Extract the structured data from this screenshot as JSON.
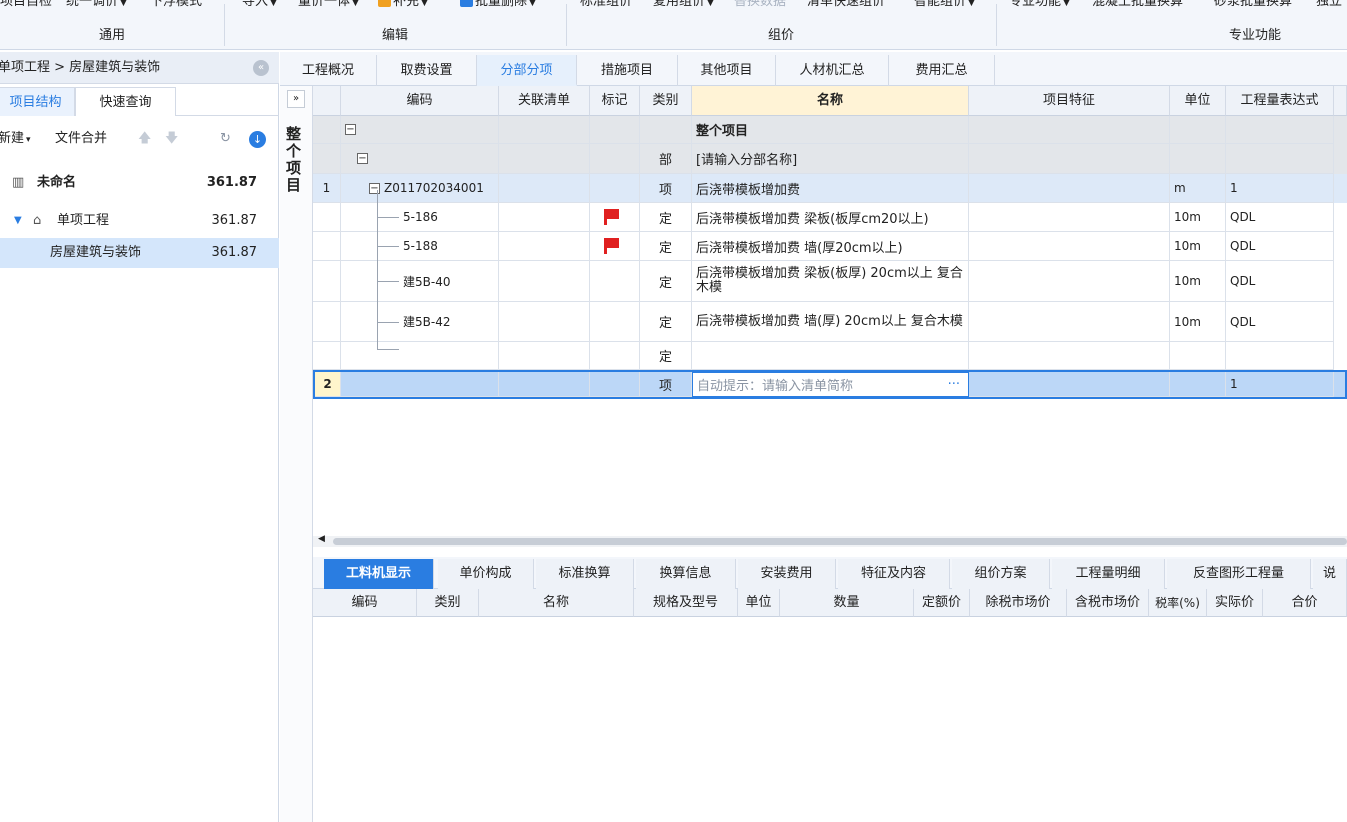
{
  "toolbar": {
    "row1": {
      "project_check": "项目自检",
      "unified_adjust": "统一调价",
      "float_mode": "下浮模式",
      "import": "导入",
      "price_volume": "量价一体",
      "supplement": "补充",
      "batch_delete": "批量删除",
      "standard_pricing": "标准组价",
      "reuse_pricing": "复用组价",
      "replace_data": "替换数据",
      "list_quick_pricing": "清单快速组价",
      "smart_pricing": "智能组价",
      "pro_function": "专业功能",
      "concrete_batch": "混凝土批量换算",
      "mortar_batch": "砂浆批量换算",
      "independent": "独立"
    },
    "groups": {
      "general": "通用",
      "edit": "编辑",
      "pricing": "组价",
      "professional": "专业功能"
    }
  },
  "left": {
    "breadcrumb": "单项工程 > 房屋建筑与装饰",
    "tabs": [
      "项目结构",
      "快速查询"
    ],
    "tools": {
      "new": "新建",
      "merge": "文件合并"
    },
    "tree": [
      {
        "label": "未命名",
        "value": "361.87"
      },
      {
        "label": "单项工程",
        "value": "361.87"
      },
      {
        "label": "房屋建筑与装饰",
        "value": "361.87"
      }
    ]
  },
  "gutter_label": "整个项目",
  "main_tabs": [
    "工程概况",
    "取费设置",
    "分部分项",
    "措施项目",
    "其他项目",
    "人材机汇总",
    "费用汇总"
  ],
  "grid": {
    "headers": [
      "编码",
      "关联清单",
      "标记",
      "类别",
      "名称",
      "项目特征",
      "单位",
      "工程量表达式"
    ],
    "rows": [
      {
        "num": "",
        "code": "",
        "type": "",
        "name": "整个项目",
        "unit": "",
        "expr": ""
      },
      {
        "num": "",
        "code": "",
        "type": "部",
        "name": "[请输入分部名称]",
        "unit": "",
        "expr": ""
      },
      {
        "num": "1",
        "code": "Z011702034001",
        "type": "项",
        "name": "后浇带模板增加费",
        "unit": "m",
        "expr": "1"
      },
      {
        "num": "",
        "code": "5-186",
        "type": "定",
        "name": "后浇带模板增加费 梁板(板厚cm20以上)",
        "unit": "10m",
        "expr": "QDL"
      },
      {
        "num": "",
        "code": "5-188",
        "type": "定",
        "name": "后浇带模板增加费 墙(厚20cm以上)",
        "unit": "10m",
        "expr": "QDL"
      },
      {
        "num": "",
        "code": "建5B-40",
        "type": "定",
        "name": "后浇带模板增加费 梁板(板厚) 20cm以上 复合木模",
        "unit": "10m",
        "expr": "QDL"
      },
      {
        "num": "",
        "code": "建5B-42",
        "type": "定",
        "name": "后浇带模板增加费 墙(厚) 20cm以上 复合木模",
        "unit": "10m",
        "expr": "QDL"
      },
      {
        "num": "",
        "code": "",
        "type": "定",
        "name": "",
        "unit": "",
        "expr": ""
      },
      {
        "num": "2",
        "code": "",
        "type": "项",
        "name": "自动提示：请输入清单简称",
        "unit": "",
        "expr": "1"
      }
    ],
    "ellipsis": "···"
  },
  "bottom_tabs": [
    "工料机显示",
    "单价构成",
    "标准换算",
    "换算信息",
    "安装费用",
    "特征及内容",
    "组价方案",
    "工程量明细",
    "反查图形工程量",
    "说"
  ],
  "bottom_headers": [
    "编码",
    "类别",
    "名称",
    "规格及型号",
    "单位",
    "数量",
    "定额价",
    "除税市场价",
    "含税市场价",
    "税率(%)",
    "实际价",
    "合价"
  ],
  "colors": {
    "accent": "#2a7de1",
    "flag": "#e02020"
  }
}
